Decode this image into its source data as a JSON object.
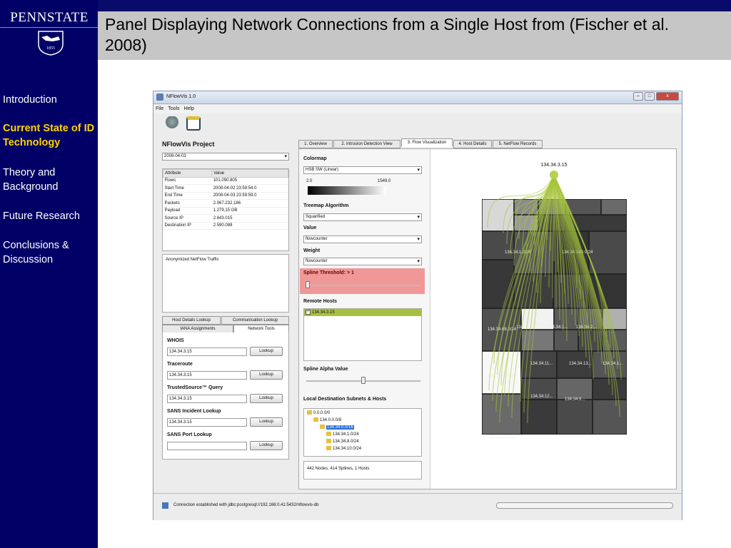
{
  "sidebar": {
    "logo": "PENNSTATE",
    "logo_year": "1855",
    "items": [
      {
        "label": "Introduction",
        "active": false
      },
      {
        "label": "Current State of ID Technology",
        "active": true
      },
      {
        "label": "Theory and Background",
        "active": false
      },
      {
        "label": "Future Research",
        "active": false
      },
      {
        "label": "Conclusions & Discussion",
        "active": false
      }
    ]
  },
  "title": "Panel Displaying Network Connections from a Single Host from (Fischer et al. 2008)",
  "app": {
    "window_title": "NFlowVis 1.0",
    "window_controls": [
      "–",
      "□",
      "x"
    ],
    "menu": [
      "File",
      "Tools",
      "Help"
    ],
    "project_title": "NFlowVis Project",
    "date_select": "2008-04-03",
    "attr_table": {
      "headers": [
        "Attribute",
        "Value"
      ],
      "rows": [
        [
          "Flows",
          "101.090.805"
        ],
        [
          "Start Time",
          "2008-04-02 23:59:54.0"
        ],
        [
          "End Time",
          "2008-04-03 23:59:59.0"
        ],
        [
          "Packets",
          "2.067.232.186"
        ],
        [
          "Payload",
          "1.279,15 GB"
        ],
        [
          "Source IP",
          "2.643.015"
        ],
        [
          "Destination IP",
          "2.590.088"
        ]
      ]
    },
    "description": "Anonymized NetFlow Traffic",
    "lookup_tabs_row1": [
      "Host Details Lookup",
      "Communication Lookup"
    ],
    "lookup_tabs_row2": [
      "IANA Assignments",
      "Network Tools"
    ],
    "lookups": [
      {
        "label": "WHOIS",
        "value": "134.34.3.15",
        "button": "Lookup"
      },
      {
        "label": "Traceroute",
        "value": "134.34.3.15",
        "button": "Lookup"
      },
      {
        "label": "TrustedSource™ Query",
        "value": "134.34.3.15",
        "button": "Lookup"
      },
      {
        "label": "SANS Incident Lookup",
        "value": "134.34.3.15",
        "button": "Lookup"
      },
      {
        "label": "SANS Port Lookup",
        "value": "",
        "button": "Lookup"
      }
    ],
    "main_tabs": [
      {
        "label": "1. Overview",
        "selected": false
      },
      {
        "label": "2. Intrusion Detection View",
        "selected": false
      },
      {
        "label": "3. Flow Visualization",
        "selected": true
      },
      {
        "label": "4. Host Details",
        "selected": false
      },
      {
        "label": "5. NetFlow Records",
        "selected": false
      }
    ],
    "colormap_label": "Colormap",
    "colormap_select": "HSB SW (Linear)",
    "colormap_min": "2.0",
    "colormap_max": "1549.0",
    "treemap_label": "Treemap Algorithm",
    "treemap_select": "Squarified",
    "value_label": "Value",
    "value_select": "flowcounter",
    "weight_label": "Weight",
    "weight_select": "flowcounter",
    "spline_threshold_label": "Spline Threshold: > 1",
    "spline_threshold_value": 0.02,
    "remote_hosts_label": "Remote Hosts",
    "remote_hosts": [
      "134.34.3.15"
    ],
    "spline_alpha_label": "Spline Alpha Value",
    "spline_alpha_value": 0.5,
    "subnets_label": "Local Destination Subnets & Hosts",
    "subnets": [
      {
        "label": "0.0.0.0/0",
        "indent": 0,
        "selected": false
      },
      {
        "label": "134.0.0.0/8",
        "indent": 1,
        "selected": false
      },
      {
        "label": "134.34.0.0/16",
        "indent": 2,
        "selected": true
      },
      {
        "label": "134.34.1.0/24",
        "indent": 3,
        "selected": false
      },
      {
        "label": "134.34.8.0/24",
        "indent": 3,
        "selected": false
      },
      {
        "label": "134.34.10.0/24",
        "indent": 3,
        "selected": false
      }
    ],
    "summary": "442 Nodes, 414 Splines, 1 Hosts",
    "viz_host_label": "134.34.3.15",
    "treemap_labels": [
      "134.34.1.0/24",
      "134.34.140.0/24",
      "134.34.68.0/24",
      "134.34.5...",
      "134.34.1...",
      "134.34.2...",
      "134.34.58.0/24",
      "134.34.11...",
      "134.34.13...",
      "134.34.1...",
      "134.34.12...",
      "134.34.9...",
      "134.34.53.0/24",
      "134.34.14...",
      "134.34.1..."
    ],
    "status_text": "Connection established with jdbc:postgresql://192.168.0.41:5432/nflowvis-db"
  }
}
